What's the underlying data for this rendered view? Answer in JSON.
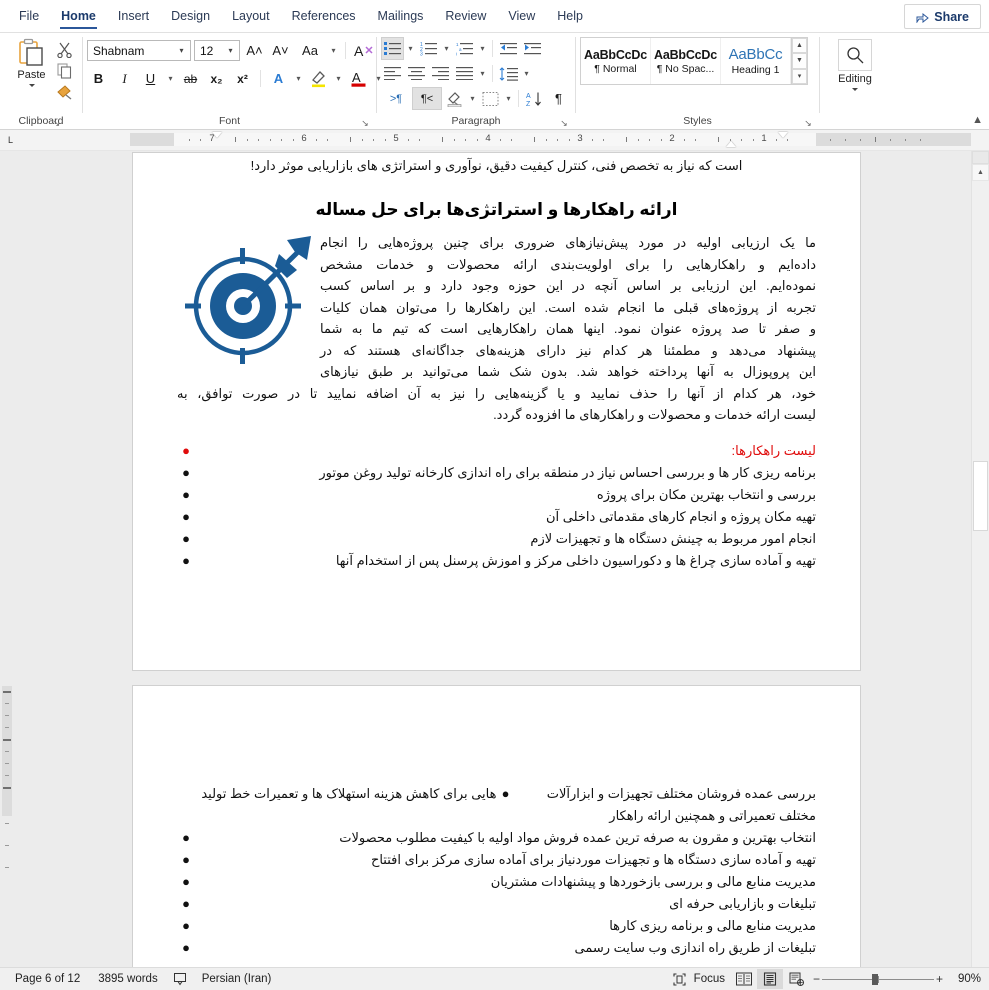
{
  "window": {
    "tabs": [
      {
        "label": "File",
        "active": false
      },
      {
        "label": "Home",
        "active": true
      },
      {
        "label": "Insert",
        "active": false
      },
      {
        "label": "Design",
        "active": false
      },
      {
        "label": "Layout",
        "active": false
      },
      {
        "label": "References",
        "active": false
      },
      {
        "label": "Mailings",
        "active": false
      },
      {
        "label": "Review",
        "active": false
      },
      {
        "label": "View",
        "active": false
      },
      {
        "label": "Help",
        "active": false
      }
    ],
    "share_label": "Share"
  },
  "ribbon": {
    "clipboard": {
      "group_label": "Clipboard",
      "paste_label": "Paste",
      "cut_icon": "scissors-icon",
      "copy_icon": "copy-icon",
      "format_painter_icon": "format-painter-icon",
      "dialog_launcher": "↘"
    },
    "font": {
      "group_label": "Font",
      "font_name": "Shabnam",
      "font_size": "12",
      "grow_font": "A˄",
      "shrink_font": "A˅",
      "change_case": "Aa",
      "clear_formatting": "A◇",
      "bold": "B",
      "italic": "I",
      "underline": "U",
      "strikethrough": "ab",
      "subscript": "x₂",
      "superscript": "x²",
      "text_effects": "A",
      "highlight": "✎",
      "font_color": "A",
      "dialog_launcher": "↘"
    },
    "paragraph": {
      "group_label": "Paragraph",
      "bullets": "bullets-icon",
      "numbering": "numbering-icon",
      "multilevel": "multilevel-list-icon",
      "decrease_indent": "decrease-indent-icon",
      "increase_indent": "increase-indent-icon",
      "align_left": "align-left-icon",
      "align_center": "align-center-icon",
      "align_right": "align-right-icon",
      "justify": "justify-icon",
      "line_spacing": "line-spacing-icon",
      "ltr_text": ">¶",
      "rtl_text": "¶<",
      "shading": "shading-icon",
      "borders": "borders-icon",
      "sort": "sort-icon",
      "show_marks": "¶",
      "dialog_launcher": "↘"
    },
    "styles": {
      "group_label": "Styles",
      "items": [
        {
          "preview": "AaBbCcDc",
          "name": "¶ Normal",
          "kind": "normal"
        },
        {
          "preview": "AaBbCcDc",
          "name": "¶ No Spac...",
          "kind": "normal"
        },
        {
          "preview": "AaBbCс",
          "name": "Heading 1",
          "kind": "h1"
        }
      ],
      "dialog_launcher": "↘"
    },
    "editing": {
      "group_label": "Editing",
      "icon": "search-icon"
    },
    "collapse_icon": "chevron-up-icon"
  },
  "ruler": {
    "numbers": [
      "7",
      "6",
      "5",
      "4",
      "3",
      "2",
      "1"
    ],
    "tab_stop_marker": "L"
  },
  "document": {
    "top_line": "است که نیاز به تخصص فنی، کنترل کیفیت دقیق، نوآوری و استراتژی های بازاریابی موثر دارد!",
    "heading": "ارائه راهکارها و استراتژی‌ها برای حل مساله",
    "image": {
      "name": "target-arrow-icon",
      "color": "#1b5c96"
    },
    "paragraph_lines": [
      "ما یک ارزیابی اولیه در مورد پیش‌نیازهای ضروری برای چنین پروژه‌هایی را انجام",
      "داده‌ایم و راهکارهایی را برای اولویت‌بندی ارائه محصولات و خدمات مشخص",
      "نموده‌ایم. این ارزیابی بر اساس آنچه در این حوزه وجود دارد و بر اساس کسب",
      "تجربه از پروژه‌های قبلی ما انجام شده است. این راهکارها را می‌توان همان کلیات",
      "و صفر تا صد پروژه عنوان نمود. اینها همان راهکارهایی است که تیم ما به شما",
      "پیشنهاد می‌دهد و مطمئنا هر کدام نیز دارای هزینه‌های جداگانه‌ای هستند که در",
      "این پروپوزال به آنها پرداخته خواهد شد. بدون شک شما می‌توانید بر طبق نیازهای",
      "خود، هر کدام از آنها را حذف نمایید و یا گزینه‌هایی را نیز به آن اضافه نمایید تا در صورت توافق، به",
      "لیست ارائه خدمات و محصولات و راهکارهای ما افزوده گردد."
    ],
    "bullet_char": "●",
    "bullets_page1": [
      {
        "text": "لیست راهکارها:",
        "color": "#e00b0b"
      },
      {
        "text": "برنامه ریزی کار ها و بررسی احساس نیاز در منطقه برای راه اندازی کارخانه تولید روغن موتور",
        "color": "#111111"
      },
      {
        "text": "بررسی و انتخاب بهترین مکان برای پروژه",
        "color": "#111111"
      },
      {
        "text": "تهیه مکان پروژه و انجام کارهای مقدماتی داخلی آن",
        "color": "#111111"
      },
      {
        "text": "انجام امور مربوط به چینش دستگاه ها و تجهیزات لازم",
        "color": "#111111"
      },
      {
        "text": "تهیه و آماده سازی چراغ ها و دکوراسیون داخلی مرکز و اموزش پرسنل پس از استخدام آنها",
        "color": "#111111"
      }
    ],
    "bullets_page2": [
      {
        "text": "بررسی عمده فروشان مختلف تجهیزات و ابزارآلات مختلف تعمیراتی و همچنین ارائه راهکار",
        "wrap": "هایی برای کاهش هزینه استهلاک ها و تعمیرات خط تولید",
        "color": "#111111"
      },
      {
        "text": "انتخاب بهترین و مقرون به صرفه ترین عمده فروش مواد اولیه با کیفیت مطلوب محصولات",
        "color": "#111111"
      },
      {
        "text": "تهیه و آماده سازی دستگاه ها و تجهیزات موردنیاز برای آماده سازی مرکز برای افتتاح",
        "color": "#111111"
      },
      {
        "text": "مدیریت منابع مالی و بررسی بازخوردها و پیشنهادات مشتریان",
        "color": "#111111"
      },
      {
        "text": "تبلیغات و بازاریابی حرفه ای",
        "color": "#111111"
      },
      {
        "text": "مدیریت منابع مالی و برنامه ریزی کارها",
        "color": "#111111"
      },
      {
        "text": "تبلیغات از طریق راه اندازی وب سایت رسمی",
        "color": "#111111"
      }
    ]
  },
  "status_bar": {
    "page_info": "Page 6 of 12",
    "word_count": "3895 words",
    "proofing_icon": "proofing-errors-icon",
    "language": "Persian (Iran)",
    "focus_label": "Focus",
    "read_mode_icon": "read-mode-icon",
    "print_layout_icon": "print-layout-icon",
    "web_layout_icon": "web-layout-icon",
    "zoom_out": "−",
    "zoom_in": "+",
    "zoom_value": "90%"
  }
}
